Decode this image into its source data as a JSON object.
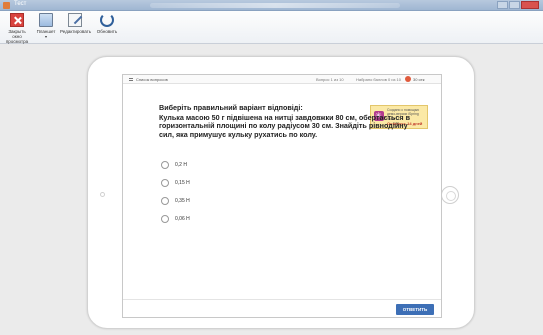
{
  "window": {
    "title": "Тест"
  },
  "ribbon": {
    "close_label": "Закрыть окно просмотра",
    "tablet_label": "Планшет",
    "edit_label": "Редактировать",
    "refresh_label": "Обновить"
  },
  "player": {
    "list_label": "Список вопросов",
    "question_counter": "Вопрос 1 из 10",
    "score": "Набрано баллов 0 из 10",
    "timer": "30 сек",
    "tooltip_text": "Создано с помощью демо-версии iSpring Suite",
    "tooltip_remaining": "Осталось 14 дней",
    "instruction": "Виберіть правильний варіант відповіді:",
    "question": "Кулька масою 50 г підвішена на нитці завдовжки 80 см, обертається в горизонтальній площині по колу радіусом 30 см. Знайдіть рівнодійну сил, яка примушує кульку рухатись по колу.",
    "answers": [
      "0,2 Н",
      "0,15 Н",
      "0,35 Н",
      "0,06 Н"
    ],
    "answer_button": "ОТВЕТИТЬ"
  },
  "colors": {
    "accent": "#3d6fb6",
    "timer": "#e05a3c",
    "close": "#d9433e"
  }
}
